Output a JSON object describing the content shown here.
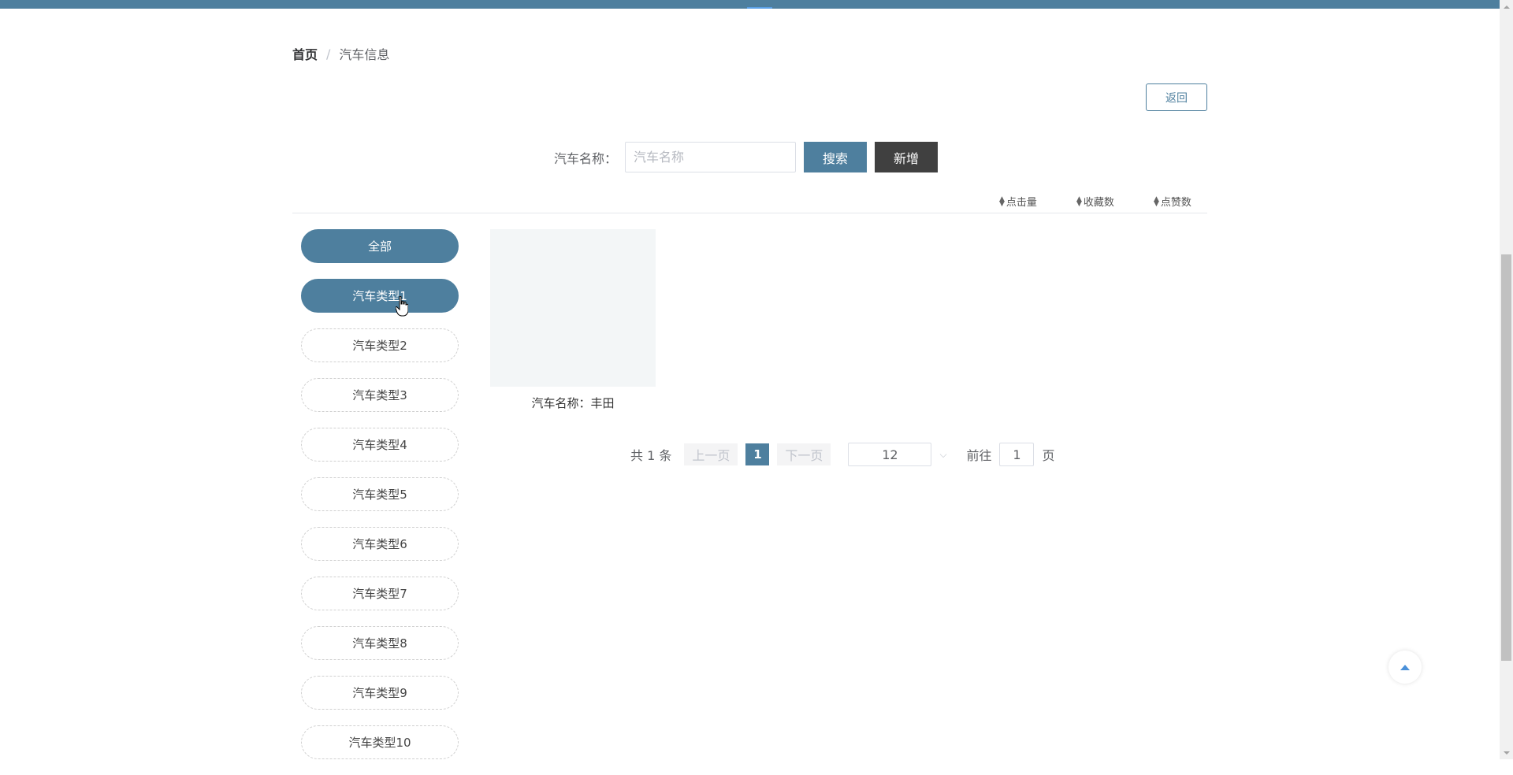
{
  "breadcrumb": {
    "home": "首页",
    "separator": "/",
    "current": "汽车信息"
  },
  "back_button": "返回",
  "search": {
    "label": "汽车名称：",
    "placeholder": "汽车名称",
    "value": "",
    "search_button": "搜索",
    "add_button": "新增"
  },
  "sort": {
    "items": [
      {
        "label": "点击量",
        "icon": "sort-icon"
      },
      {
        "label": "收藏数",
        "icon": "sort-icon"
      },
      {
        "label": "点赞数",
        "icon": "sort-icon"
      }
    ]
  },
  "categories": [
    {
      "label": "全部",
      "active": true
    },
    {
      "label": "汽车类型1",
      "active": true
    },
    {
      "label": "汽车类型2",
      "active": false
    },
    {
      "label": "汽车类型3",
      "active": false
    },
    {
      "label": "汽车类型4",
      "active": false
    },
    {
      "label": "汽车类型5",
      "active": false
    },
    {
      "label": "汽车类型6",
      "active": false
    },
    {
      "label": "汽车类型7",
      "active": false
    },
    {
      "label": "汽车类型8",
      "active": false
    },
    {
      "label": "汽车类型9",
      "active": false
    },
    {
      "label": "汽车类型10",
      "active": false
    }
  ],
  "items": [
    {
      "label": "汽车名称：",
      "name": "丰田"
    }
  ],
  "pagination": {
    "total_prefix": "共",
    "total_count": "1",
    "total_suffix": "条",
    "prev": "上一页",
    "current_page": "1",
    "next": "下一页",
    "page_size": "12",
    "goto_label": "前往",
    "goto_value": "1",
    "goto_suffix": "页"
  },
  "colors": {
    "primary": "#4e7f9e",
    "dark_button": "#404040",
    "back_top_icon": "#4a90d9"
  }
}
